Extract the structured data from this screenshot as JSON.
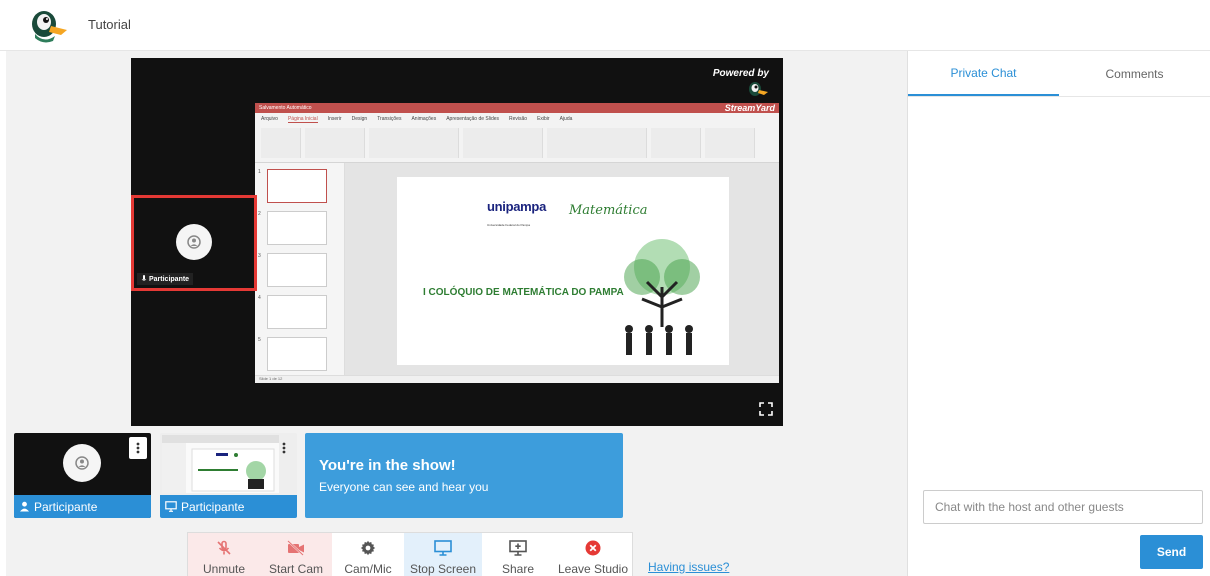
{
  "app": {
    "title": "Tutorial"
  },
  "stage": {
    "powered_by": "Powered by",
    "brand": "StreamYard",
    "participant_name": "Participante",
    "screen_share": {
      "ppt_title": "Salvamento Automático",
      "menu": [
        "Arquivo",
        "Página Inicial",
        "Inserir",
        "Design",
        "Transições",
        "Animações",
        "Apresentação de Slides",
        "Revisão",
        "Exibir",
        "Ajuda"
      ],
      "active_menu": "Página Inicial",
      "slide_count_label": "Slide 1 de 12",
      "slide": {
        "uni_logo": "unipampa",
        "uni_sub": "Universidade Federal do Pampa",
        "mat_logo": "Matemática",
        "heading": "I COLÓQUIO DE MATEMÁTICA DO PAMPA"
      },
      "thumb_numbers": [
        "1",
        "2",
        "3",
        "4",
        "5"
      ]
    }
  },
  "tiles": [
    {
      "name": "Participante",
      "type": "camera",
      "icon": "person-icon"
    },
    {
      "name": "Participante",
      "type": "screen",
      "icon": "monitor-icon"
    }
  ],
  "banner": {
    "title": "You're in the show!",
    "subtitle": "Everyone can see and hear you"
  },
  "controls": [
    {
      "label": "Unmute",
      "icon": "mic-off-icon",
      "state": "red"
    },
    {
      "label": "Start Cam",
      "icon": "camera-off-icon",
      "state": "red"
    },
    {
      "label": "Cam/Mic",
      "icon": "gear-icon",
      "state": "normal"
    },
    {
      "label": "Stop Screen",
      "icon": "monitor-icon",
      "state": "blue"
    },
    {
      "label": "Share",
      "icon": "share-icon",
      "state": "normal"
    },
    {
      "label": "Leave Studio",
      "icon": "close-circle-icon",
      "state": "normal"
    }
  ],
  "issues_link": "Having issues?",
  "chat": {
    "tabs": [
      "Private Chat",
      "Comments"
    ],
    "active_tab": "Private Chat",
    "placeholder": "Chat with the host and other guests",
    "send_label": "Send"
  },
  "colors": {
    "accent": "#2b8fd6",
    "danger": "#e53935",
    "banner": "#3d9ddc"
  }
}
